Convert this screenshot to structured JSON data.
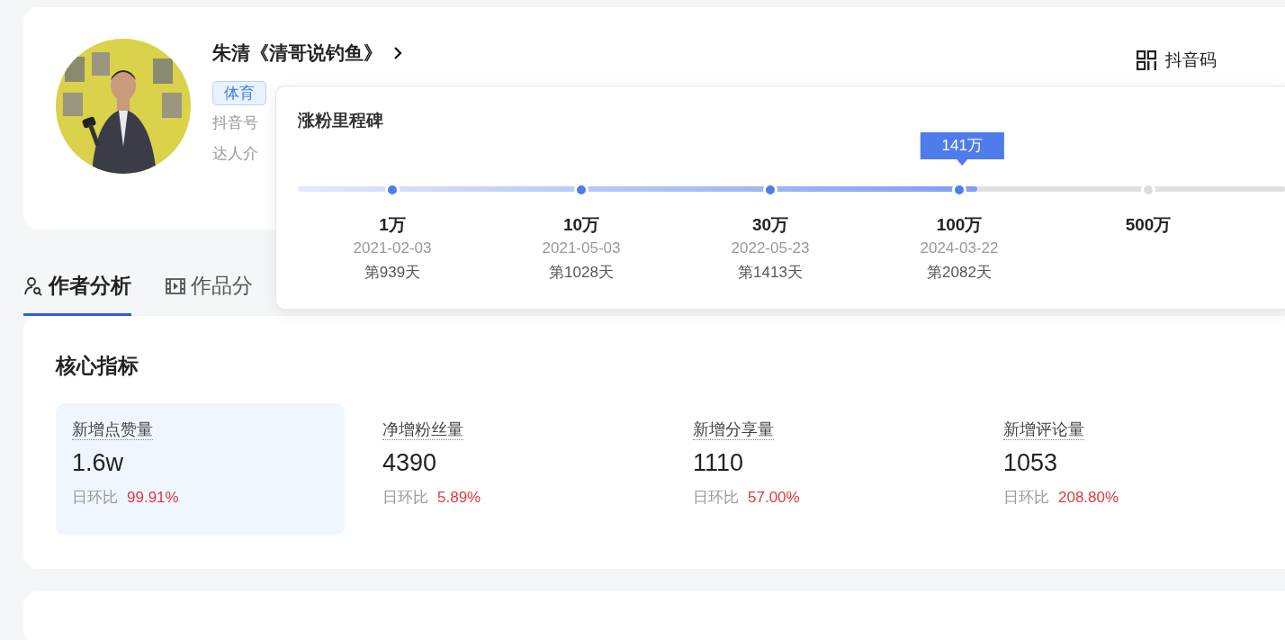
{
  "profile": {
    "name": "朱清《清哥说钓鱼》",
    "tag": "体育",
    "account_label": "抖音号",
    "intro_label": "达人介",
    "qr_link": "抖音码"
  },
  "milestones": {
    "title": "涨粉里程碑",
    "current": "141万",
    "level": 0.688,
    "items": [
      {
        "value": "1万",
        "date": "2021-02-03",
        "day": "第939天",
        "reached": true
      },
      {
        "value": "10万",
        "date": "2021-05-03",
        "day": "第1028天",
        "reached": true
      },
      {
        "value": "30万",
        "date": "2022-05-23",
        "day": "第1413天",
        "reached": true
      },
      {
        "value": "100万",
        "date": "2024-03-22",
        "day": "第2082天",
        "reached": true
      },
      {
        "value": "500万",
        "reached": false
      }
    ]
  },
  "tabs": [
    {
      "label": "作者分析",
      "kind": "person",
      "selected": true
    },
    {
      "label": "作品分",
      "kind": "film",
      "selected": false
    }
  ],
  "core": {
    "title": "核心指标",
    "metrics": [
      {
        "label": "新增点赞量",
        "value": "1.6w",
        "change_label": "日环比",
        "change": "99.91%",
        "selected": true
      },
      {
        "label": "净增粉丝量",
        "value": "4390",
        "change_label": "日环比",
        "change": "5.89%",
        "selected": false
      },
      {
        "label": "新增分享量",
        "value": "1110",
        "change_label": "日环比",
        "change": "57.00%",
        "selected": false
      },
      {
        "label": "新增评论量",
        "value": "1053",
        "change_label": "日环比",
        "change": "208.80%",
        "selected": false
      }
    ]
  }
}
